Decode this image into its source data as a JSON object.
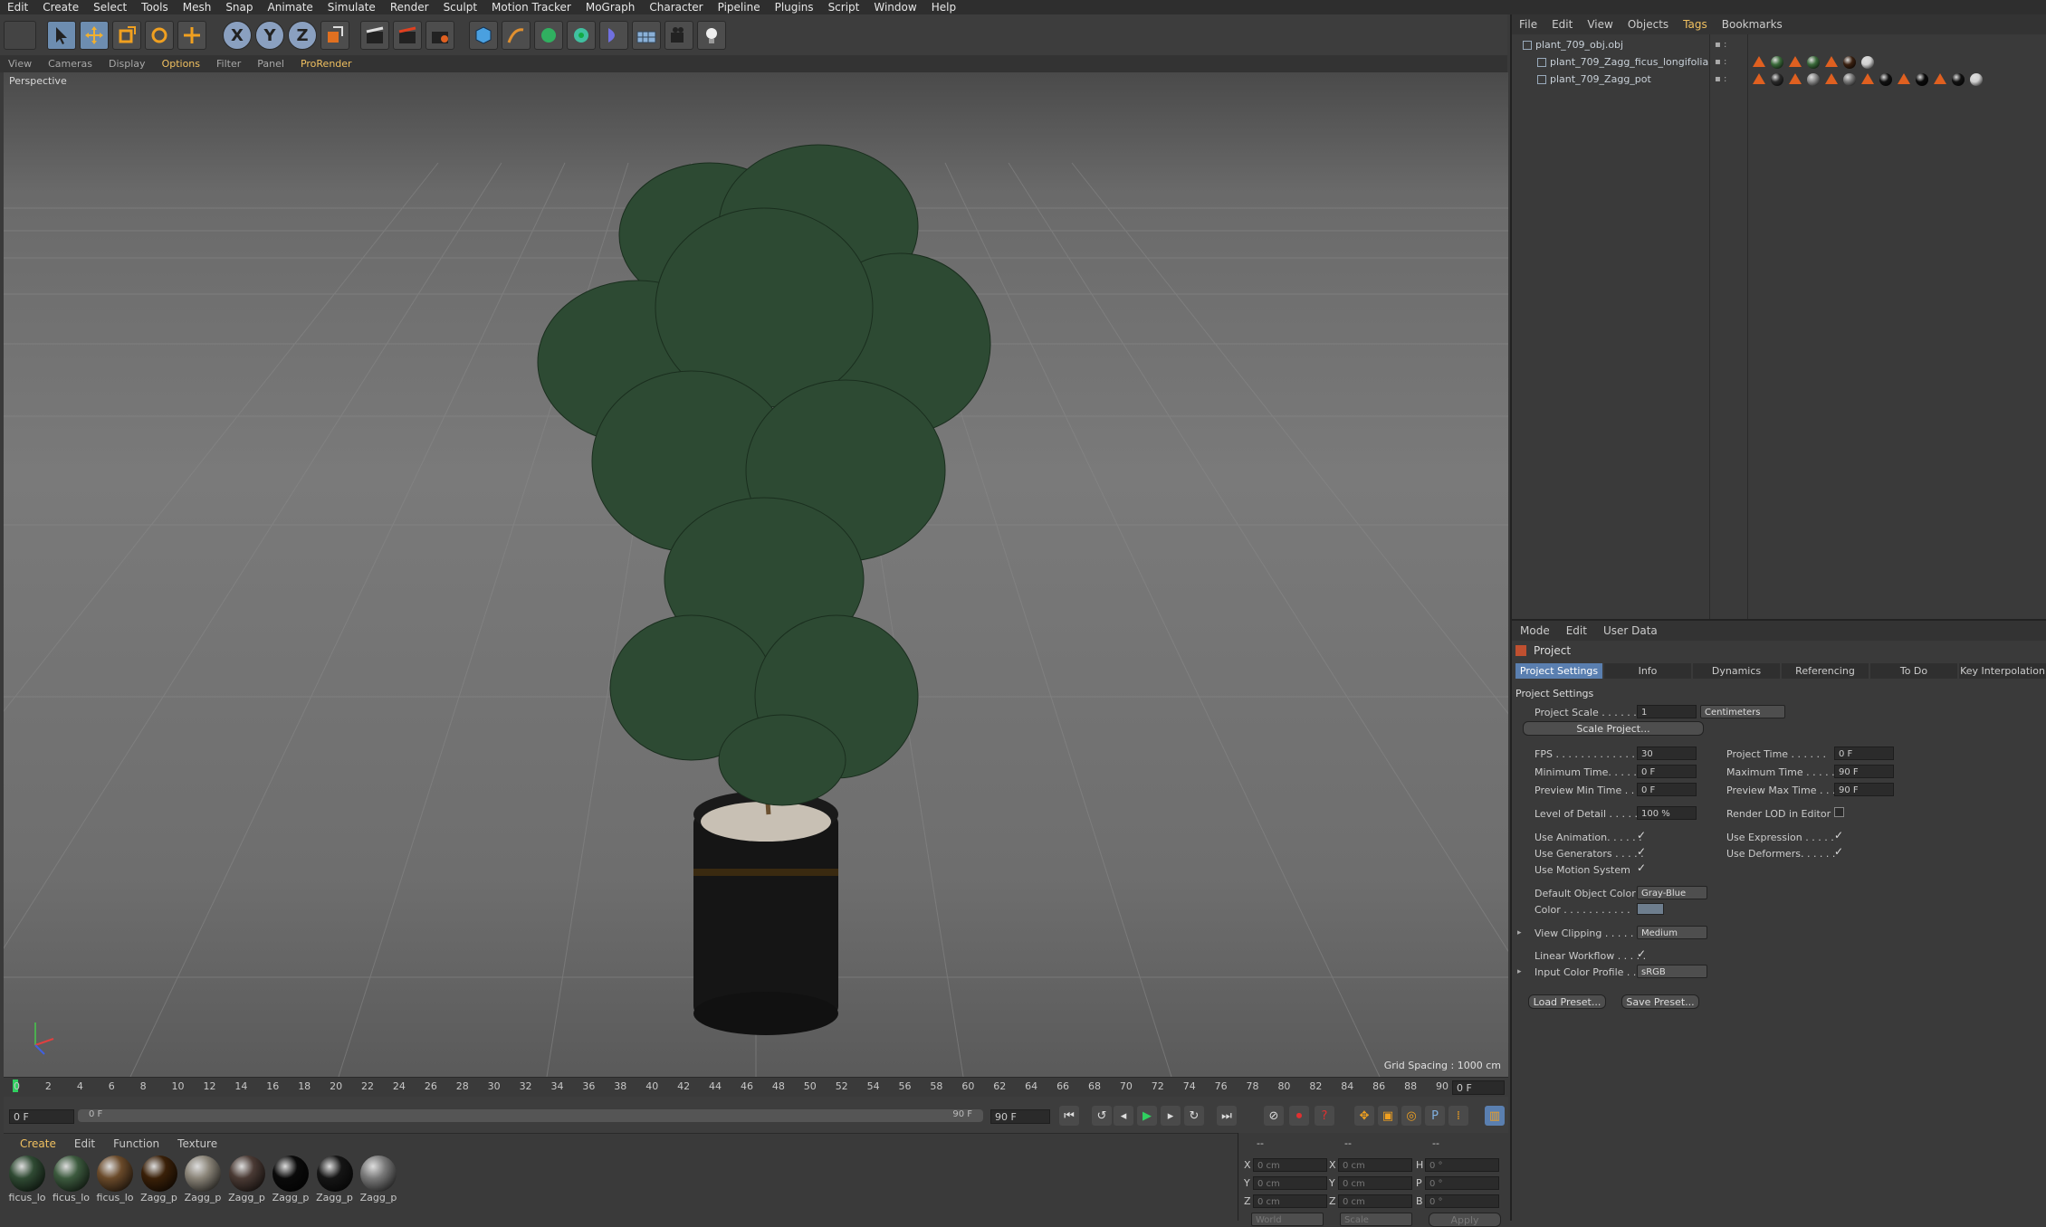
{
  "menubar": [
    "Edit",
    "Create",
    "Select",
    "Tools",
    "Mesh",
    "Snap",
    "Animate",
    "Simulate",
    "Render",
    "Sculpt",
    "Motion Tracker",
    "MoGraph",
    "Character",
    "Pipeline",
    "Plugins",
    "Script",
    "Window",
    "Help"
  ],
  "viewport_menu": [
    "View",
    "Cameras",
    "Display",
    "Options",
    "Filter",
    "Panel",
    "ProRender"
  ],
  "viewport": {
    "label": "Perspective",
    "grid_spacing": "Grid Spacing : 1000 cm"
  },
  "timeline": {
    "ticks": [
      "0",
      "2",
      "4",
      "6",
      "8",
      "10",
      "12",
      "14",
      "16",
      "18",
      "20",
      "22",
      "24",
      "26",
      "28",
      "30",
      "32",
      "34",
      "36",
      "38",
      "40",
      "42",
      "44",
      "46",
      "48",
      "50",
      "52",
      "54",
      "56",
      "58",
      "60",
      "62",
      "64",
      "66",
      "68",
      "70",
      "72",
      "74",
      "76",
      "78",
      "80",
      "82",
      "84",
      "86",
      "88",
      "90"
    ],
    "current_frame": "0 F",
    "start_field": "0 F",
    "range_start": "0 F",
    "range_end": "90 F",
    "end_field": "90 F"
  },
  "materials": {
    "menu": [
      "Create",
      "Edit",
      "Function",
      "Texture"
    ],
    "items": [
      {
        "label": "ficus_lo",
        "color": "#2f4a33"
      },
      {
        "label": "ficus_lo",
        "color": "#3c5a3e"
      },
      {
        "label": "ficus_lo",
        "color": "#6a4a2a"
      },
      {
        "label": "Zagg_p",
        "color": "#3a2008"
      },
      {
        "label": "Zagg_p",
        "color": "#8a8478"
      },
      {
        "label": "Zagg_p",
        "color": "#4a3a34"
      },
      {
        "label": "Zagg_p",
        "color": "#0a0a0a"
      },
      {
        "label": "Zagg_p",
        "color": "#151515"
      },
      {
        "label": "Zagg_p",
        "color": "#7a7a7a"
      }
    ]
  },
  "coordinates": {
    "header": [
      "--",
      "--",
      "--"
    ],
    "rows": [
      {
        "a": "X",
        "av": "0 cm",
        "b": "X",
        "bv": "0 cm",
        "c": "H",
        "cv": "0 °"
      },
      {
        "a": "Y",
        "av": "0 cm",
        "b": "Y",
        "bv": "0 cm",
        "c": "P",
        "cv": "0 °"
      },
      {
        "a": "Z",
        "av": "0 cm",
        "b": "Z",
        "bv": "0 cm",
        "c": "B",
        "cv": "0 °"
      }
    ],
    "footer": [
      "World",
      "Scale",
      "Apply"
    ]
  },
  "object_manager": {
    "menu": [
      "File",
      "Edit",
      "View",
      "Objects",
      "Tags",
      "Bookmarks"
    ],
    "objects": [
      {
        "name": "plant_709_obj.obj",
        "level": 0
      },
      {
        "name": "plant_709_Zagg_ficus_longifolia",
        "level": 1
      },
      {
        "name": "plant_709_Zagg_pot",
        "level": 1
      }
    ]
  },
  "attributes": {
    "menu": [
      "Mode",
      "Edit",
      "User Data"
    ],
    "title": "Project",
    "tabs": [
      "Project Settings",
      "Info",
      "Dynamics",
      "Referencing",
      "To Do",
      "Key Interpolation"
    ],
    "section": "Project Settings",
    "project_scale_label": "Project Scale . . . . . . .",
    "project_scale_value": "1",
    "project_scale_unit": "Centimeters",
    "scale_button": "Scale Project...",
    "fps_label": "FPS . . . . . . . . . . . . . .",
    "fps": "30",
    "project_time_label": "Project Time . . . . . .",
    "project_time": "0 F",
    "min_time_label": "Minimum Time. . . . . .",
    "min_time": "0 F",
    "max_time_label": "Maximum Time . . . . .",
    "max_time": "90 F",
    "prev_min_label": "Preview Min Time . . .",
    "prev_min": "0 F",
    "prev_max_label": "Preview Max Time . . . .",
    "prev_max": "90 F",
    "lod_label": "Level of Detail . . . . . .",
    "lod": "100 %",
    "render_lod_label": "Render LOD in Editor",
    "use_anim_label": "Use Animation. . . . . .",
    "use_expr_label": "Use Expression . . . . .",
    "use_gen_label": "Use Generators . . . . .",
    "use_def_label": "Use Deformers. . . . . .",
    "use_motion_label": "Use Motion System",
    "default_color_label": "Default Object Color",
    "default_color": "Gray-Blue",
    "color_label": "Color . . . . . . . . . . .",
    "color_swatch": "#6e7e8e",
    "view_clip_label": "View Clipping . . . . .",
    "view_clip": "Medium",
    "linear_label": "Linear Workflow . . . . .",
    "input_profile_label": "Input Color Profile . .",
    "input_profile": "sRGB",
    "load_preset": "Load Preset...",
    "save_preset": "Save Preset..."
  }
}
